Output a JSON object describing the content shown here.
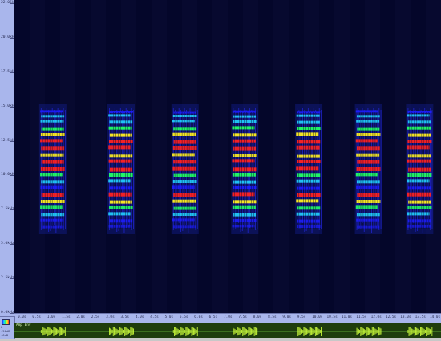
{
  "freq_axis": {
    "labels": [
      "22.05kHz",
      "20.0kHz",
      "17.5kHz",
      "15.0kHz",
      "12.5kHz",
      "10.0kHz",
      "7.5kHz",
      "5.0kHz",
      "2.5kHz",
      "0.0kHz"
    ]
  },
  "time_axis": {
    "labels": [
      "0.0s",
      "0.5s",
      "1.0s",
      "1.5s",
      "2.0s",
      "2.5s",
      "3.0s",
      "3.5s",
      "4.0s",
      "4.5s",
      "5.0s",
      "5.5s",
      "6.0s",
      "6.5s",
      "7.0s",
      "7.5s",
      "8.0s",
      "8.5s",
      "9.0s",
      "9.5s",
      "10.0s",
      "10.5s",
      "11.0s",
      "11.5s",
      "12.0s",
      "12.5s",
      "13.0s",
      "13.5s",
      "14.0s"
    ]
  },
  "colors": {
    "spectrogram_bg": "#05072c",
    "axis_bg": "#a9b6ec",
    "waveform_bg": "#1f3d0d",
    "waveform_trace": "#cfff3c"
  },
  "colormap": [
    "#1d1dff",
    "#22d2ff",
    "#22ff66",
    "#fff022",
    "#ff2222"
  ],
  "mini_panel": {
    "lines": [
      "L",
      "-96dB",
      "-6dB"
    ]
  },
  "waveform_strip": {
    "title": "Amp Env"
  },
  "bursts": [
    {
      "t": 0.09
    },
    {
      "t": 0.25
    },
    {
      "t": 0.4
    },
    {
      "t": 0.54
    },
    {
      "t": 0.69
    },
    {
      "t": 0.83
    },
    {
      "t": 0.95
    }
  ]
}
